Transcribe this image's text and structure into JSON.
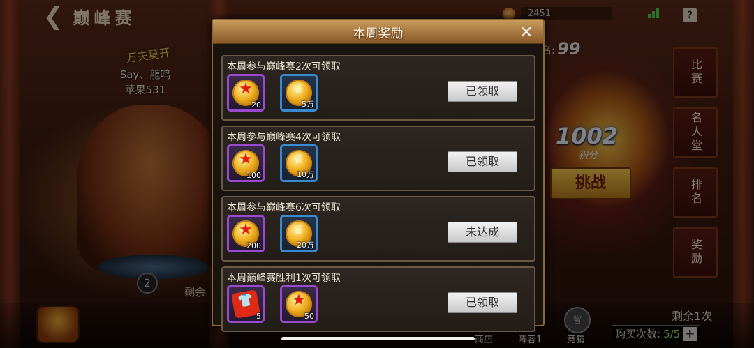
{
  "header": {
    "title": "巅峰赛"
  },
  "currency": {
    "value": "2451"
  },
  "player": {
    "name": "Say、龍鸣",
    "server": "苹果531",
    "logo_text": "万夫莫开"
  },
  "hero": {
    "rank_badge": "2",
    "remaining_label": "剩余"
  },
  "rank": {
    "label": "名:",
    "value": "99"
  },
  "score": {
    "value": "1002",
    "label": "积分"
  },
  "challenge_button": "挑战",
  "side_tabs": [
    {
      "label": "比赛"
    },
    {
      "label": "名人堂"
    },
    {
      "label": "排名"
    },
    {
      "label": "奖励"
    }
  ],
  "bottom": {
    "shop": "商店",
    "lineup": "阵容1",
    "guess": "竞猜",
    "remaining": "剩余1次",
    "buy_label": "购买次数:",
    "buy_count": "5/5",
    "plus": "+"
  },
  "modal": {
    "title": "本周奖励",
    "close": "×",
    "rows": [
      {
        "title": "本周参与巅峰赛2次可领取",
        "items": [
          {
            "type": "star-coin",
            "frame": "purple",
            "qty": "20"
          },
          {
            "type": "gold-coin",
            "frame": "blue",
            "qty": "5万"
          }
        ],
        "status": "已领取"
      },
      {
        "title": "本周参与巅峰赛4次可领取",
        "items": [
          {
            "type": "star-coin",
            "frame": "purple",
            "qty": "100"
          },
          {
            "type": "gold-coin",
            "frame": "blue",
            "qty": "10万"
          }
        ],
        "status": "已领取"
      },
      {
        "title": "本周参与巅峰赛6次可领取",
        "items": [
          {
            "type": "star-coin",
            "frame": "purple",
            "qty": "200"
          },
          {
            "type": "gold-coin",
            "frame": "blue",
            "qty": "20万"
          }
        ],
        "status": "未达成"
      },
      {
        "title": "本周巅峰赛胜利1次可领取",
        "items": [
          {
            "type": "shirt-puzzle",
            "frame": "purple",
            "qty": "5"
          },
          {
            "type": "star-coin",
            "frame": "purple",
            "qty": "50"
          }
        ],
        "status": "已领取"
      }
    ]
  },
  "icons": {
    "back": "back-arrow-icon",
    "help": "?"
  }
}
